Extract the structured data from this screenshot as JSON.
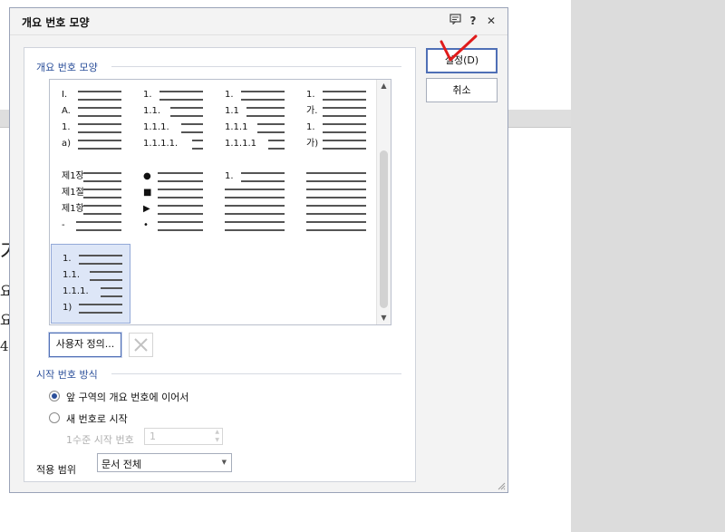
{
  "background": {
    "fragments": [
      "가",
      "요",
      "요",
      "4"
    ]
  },
  "dialog": {
    "title": "개요 번호 모양",
    "memo_icon": "memo-icon",
    "help_label": "?",
    "close_label": "✕"
  },
  "outline": {
    "section_label": "개요 번호 모양",
    "styles": [
      {
        "lines": [
          "I.",
          "A.",
          "1.",
          "a)"
        ]
      },
      {
        "lines": [
          "1.",
          "1.1.",
          "1.1.1.",
          "1.1.1.1."
        ]
      },
      {
        "lines": [
          "1.",
          "1.1",
          "1.1.1",
          "1.1.1.1"
        ]
      },
      {
        "lines": [
          "1.",
          "가.",
          "1.",
          "가)"
        ]
      },
      {
        "lines": [
          "제1장",
          "제1절",
          "제1항",
          "-"
        ]
      },
      {
        "lines": [
          "●",
          "■",
          "▶",
          "•"
        ]
      },
      {
        "lines": [
          "1.",
          "",
          "",
          ""
        ]
      },
      {
        "lines": [
          "",
          "",
          "",
          ""
        ]
      },
      {
        "lines": [
          "1.",
          "1.1.",
          "1.1.1.",
          "1)"
        ],
        "selected": true
      }
    ],
    "custom_button": "사용자 정의...",
    "delete_icon": "delete-x-icon"
  },
  "start": {
    "section_label": "시작 번호 방식",
    "continue_label": "앞 구역의 개요 번호에 이어서",
    "new_label": "새 번호로 시작",
    "level1_label": "1수준 시작 번호",
    "level1_value": "1"
  },
  "scope": {
    "label": "적용 범위",
    "value": "문서 전체"
  },
  "buttons": {
    "ok": "설정(D)",
    "cancel": "취소"
  },
  "colors": {
    "accent": "#2b4f9a",
    "annotation": "#e01b1b"
  }
}
